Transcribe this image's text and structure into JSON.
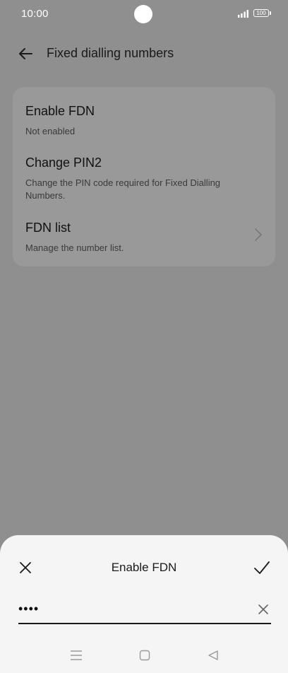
{
  "status_bar": {
    "time": "10:00",
    "battery": "100"
  },
  "header": {
    "title": "Fixed dialling numbers"
  },
  "settings": {
    "items": [
      {
        "title": "Enable FDN",
        "subtitle": "Not enabled"
      },
      {
        "title": "Change PIN2",
        "subtitle": "Change the PIN code required for Fixed Dialling Numbers."
      },
      {
        "title": "FDN list",
        "subtitle": "Manage the number list."
      }
    ]
  },
  "dialog": {
    "title": "Enable FDN",
    "pin_value": "••••"
  },
  "icons": {
    "back": "arrow-left-icon",
    "chevron": "chevron-right-icon",
    "close": "close-icon",
    "confirm": "check-icon",
    "clear": "clear-icon"
  },
  "colors": {
    "dimmed_background": "#8f8f8f",
    "card": "#999999",
    "sheet": "#f5f5f5",
    "text": "#1a1a1a"
  }
}
